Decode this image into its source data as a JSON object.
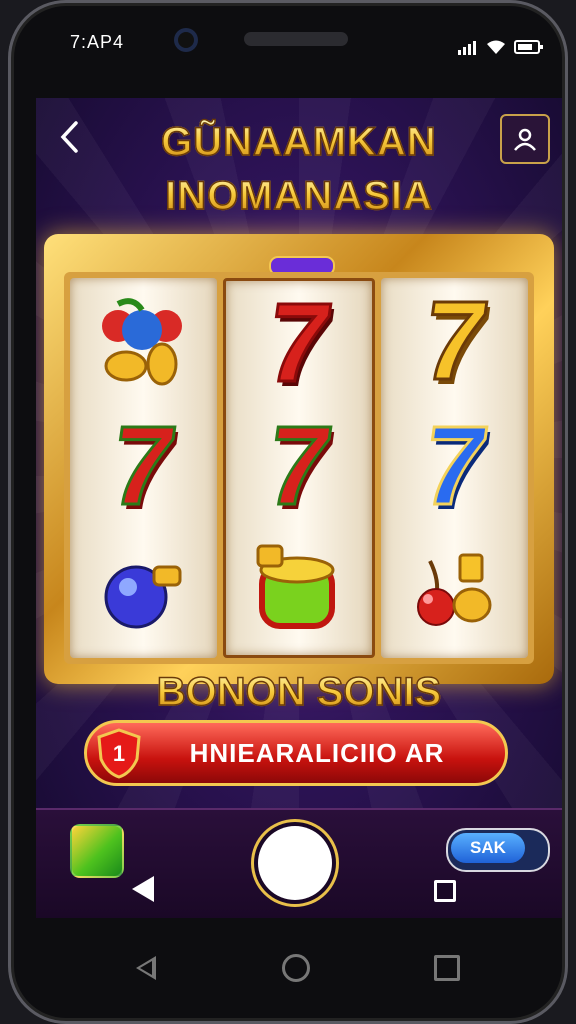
{
  "status_bar": {
    "time": "7:AP4",
    "icons": [
      "signal-icon",
      "wifi-icon",
      "battery-icon"
    ]
  },
  "header": {
    "back_icon": "chevron-left-icon",
    "title_line1": "GŨNAAMKAN",
    "title_line2": "INOMANASIA",
    "profile_icon": "user-icon"
  },
  "slot": {
    "reels": [
      [
        "fruit-coins-icon",
        "seven-red-icon",
        "potion-icon"
      ],
      [
        "seven-red-icon",
        "seven-red-icon",
        "honey-pot-icon"
      ],
      [
        "seven-gold-icon",
        "seven-blue-icon",
        "cherry-coins-icon"
      ]
    ],
    "seven_glyph": "7"
  },
  "bonus_text": "BONON SONIS",
  "cta": {
    "label": "HNIEARALICIIO AR",
    "badge": "1"
  },
  "game_bar": {
    "toggle_label": "SAK"
  },
  "colors": {
    "gold": "#f6c83a",
    "red": "#d7211c",
    "purple": "#2d1356",
    "blue": "#2a6bf0"
  }
}
